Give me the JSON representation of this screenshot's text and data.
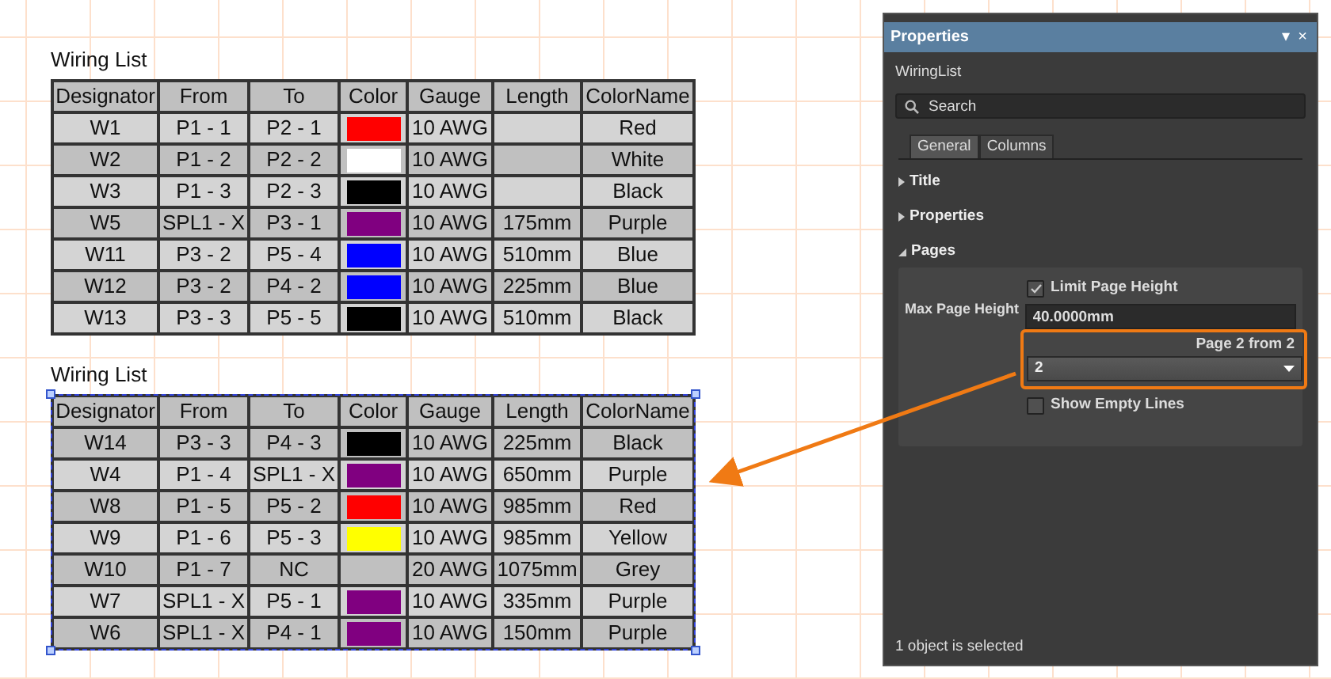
{
  "tables": [
    {
      "title": "Wiring List",
      "selected": false,
      "columns": [
        "Designator",
        "From",
        "To",
        "Color",
        "Gauge",
        "Length",
        "ColorName"
      ],
      "rows": [
        {
          "designator": "W1",
          "from": "P1 - 1",
          "to": "P2 - 1",
          "color": "#ff0000",
          "gauge": "10 AWG",
          "color_name": "Red"
        },
        {
          "designator": "W2",
          "from": "P1 - 2",
          "to": "P2 - 2",
          "color": "#ffffff",
          "gauge": "10 AWG",
          "color_name": "White"
        },
        {
          "designator": "W3",
          "from": "P1 - 3",
          "to": "P2 - 3",
          "color": "#000000",
          "gauge": "10 AWG",
          "color_name": "Black"
        },
        {
          "designator": "W5",
          "from": "SPL1 - X",
          "to": "P3 - 1",
          "color": "#800080",
          "gauge": "10 AWG",
          "length": "175mm",
          "color_name": "Purple"
        },
        {
          "designator": "W11",
          "from": "P3 - 2",
          "to": "P5 - 4",
          "color": "#0000ff",
          "gauge": "10 AWG",
          "length": "510mm",
          "color_name": "Blue"
        },
        {
          "designator": "W12",
          "from": "P3 - 2",
          "to": "P4 - 2",
          "color": "#0000ff",
          "gauge": "10 AWG",
          "length": "225mm",
          "color_name": "Blue"
        },
        {
          "designator": "W13",
          "from": "P3 - 3",
          "to": "P5 - 5",
          "color": "#000000",
          "gauge": "10 AWG",
          "length": "510mm",
          "color_name": "Black"
        }
      ]
    },
    {
      "title": "Wiring List",
      "selected": true,
      "columns": [
        "Designator",
        "From",
        "To",
        "Color",
        "Gauge",
        "Length",
        "ColorName"
      ],
      "rows": [
        {
          "designator": "W14",
          "from": "P3 - 3",
          "to": "P4 - 3",
          "color": "#000000",
          "gauge": "10 AWG",
          "length": "225mm",
          "color_name": "Black"
        },
        {
          "designator": "W4",
          "from": "P1 - 4",
          "to": "SPL1 - X",
          "color": "#800080",
          "gauge": "10 AWG",
          "length": "650mm",
          "color_name": "Purple"
        },
        {
          "designator": "W8",
          "from": "P1 - 5",
          "to": "P5 - 2",
          "color": "#ff0000",
          "gauge": "10 AWG",
          "length": "985mm",
          "color_name": "Red"
        },
        {
          "designator": "W9",
          "from": "P1 - 6",
          "to": "P5 - 3",
          "color": "#ffff00",
          "gauge": "10 AWG",
          "length": "985mm",
          "color_name": "Yellow"
        },
        {
          "designator": "W10",
          "from": "P1 - 7",
          "to": "NC",
          "gauge": "20 AWG",
          "length": "1075mm",
          "color_name": "Grey"
        },
        {
          "designator": "W7",
          "from": "SPL1 - X",
          "to": "P5 - 1",
          "color": "#800080",
          "gauge": "10 AWG",
          "length": "335mm",
          "color_name": "Purple"
        },
        {
          "designator": "W6",
          "from": "SPL1 - X",
          "to": "P4 - 1",
          "color": "#800080",
          "gauge": "10 AWG",
          "length": "150mm",
          "color_name": "Purple"
        }
      ]
    }
  ],
  "panel": {
    "title": "Properties",
    "title_buttons": [
      "▾",
      "×"
    ],
    "object_name": "WiringList",
    "search": {
      "placeholder": "Search"
    },
    "tabs": [
      {
        "label": "General",
        "selected": true
      },
      {
        "label": "Columns",
        "selected": false
      }
    ],
    "sections": [
      {
        "label": "Title",
        "expanded": false
      },
      {
        "label": "Properties",
        "expanded": false
      },
      {
        "label": "Pages",
        "expanded": true
      }
    ],
    "pages": {
      "limit_label": "Limit Page Height",
      "limit_checked": true,
      "max_label": "Max Page Height",
      "max_value": "40.0000mm",
      "page_caption": "Page 2 from 2",
      "page_value": "2",
      "empty_label": "Show Empty Lines",
      "empty_checked": false
    },
    "status": "1 object is selected"
  }
}
